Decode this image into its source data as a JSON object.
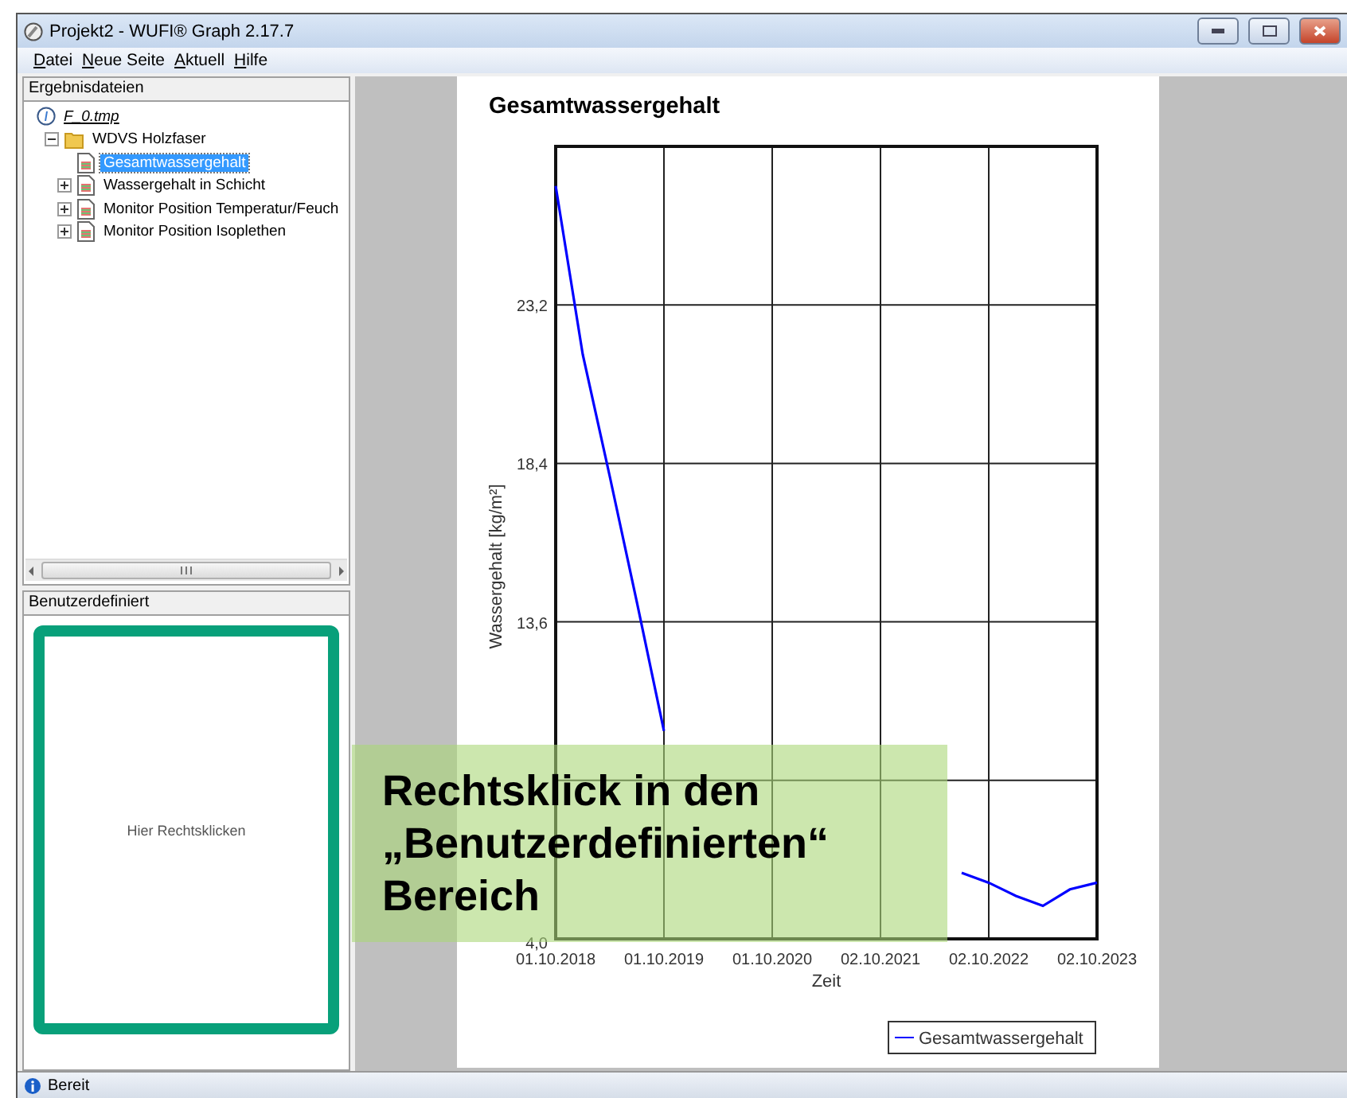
{
  "window": {
    "title": "Projekt2 - WUFI® Graph 2.17.7"
  },
  "menu": [
    "Datei",
    "Neue Seite",
    "Aktuell",
    "Hilfe"
  ],
  "results_panel": {
    "title": "Ergebnisdateien",
    "tree": [
      {
        "label": "F_0.tmp",
        "kind": "file",
        "children": [
          {
            "label": "WDVS Holzfaser",
            "kind": "folder",
            "expanded": true,
            "children": [
              {
                "label": "Gesamtwassergehalt",
                "kind": "graph",
                "selected": true
              },
              {
                "label": "Wassergehalt in Schicht",
                "kind": "graph",
                "selected": false,
                "expanded": false
              },
              {
                "label": "Monitor Position Temperatur/Feuch",
                "kind": "graph",
                "selected": false,
                "expanded": false
              },
              {
                "label": "Monitor Position Isoplethen",
                "kind": "graph",
                "selected": false,
                "expanded": false
              }
            ]
          }
        ]
      }
    ]
  },
  "custom_panel": {
    "title": "Benutzerdefiniert",
    "hint": "Hier Rechtsklicken"
  },
  "graph": {
    "chart_data": {
      "type": "line",
      "title": "Gesamtwassergehalt",
      "xlabel": "Zeit",
      "ylabel": "Wassergehalt [kg/m²]",
      "categories": [
        "01.10.2018",
        null,
        null,
        null,
        "01.10.2019",
        null,
        null,
        null,
        "01.10.2020",
        null,
        null,
        null,
        "02.10.2021",
        null,
        null,
        null,
        "02.10.2022",
        null,
        null,
        null,
        "02.10.2023"
      ],
      "series": [
        {
          "name": "Gesamtwassergehalt",
          "color": "#0000ff",
          "values": [
            26.8,
            21.7,
            18.0,
            14.2,
            10.3,
            null,
            null,
            null,
            null,
            null,
            null,
            null,
            null,
            null,
            null,
            6.0,
            5.7,
            5.3,
            5.0,
            5.5,
            5.7
          ]
        }
      ],
      "ylim": [
        4,
        28
      ],
      "grid": true,
      "yticks": [
        {
          "value": 4,
          "label": "4,0"
        },
        {
          "value": 13.6,
          "label": "13,6"
        },
        {
          "value": 18.4,
          "label": "18,4"
        },
        {
          "value": 23.2,
          "label": "23,2"
        }
      ]
    }
  },
  "callout": {
    "lines": [
      "Rechtsklick in den",
      "„Benutzerdefinierten“",
      "Bereich"
    ]
  },
  "status_bar": {
    "text": "Bereit"
  }
}
